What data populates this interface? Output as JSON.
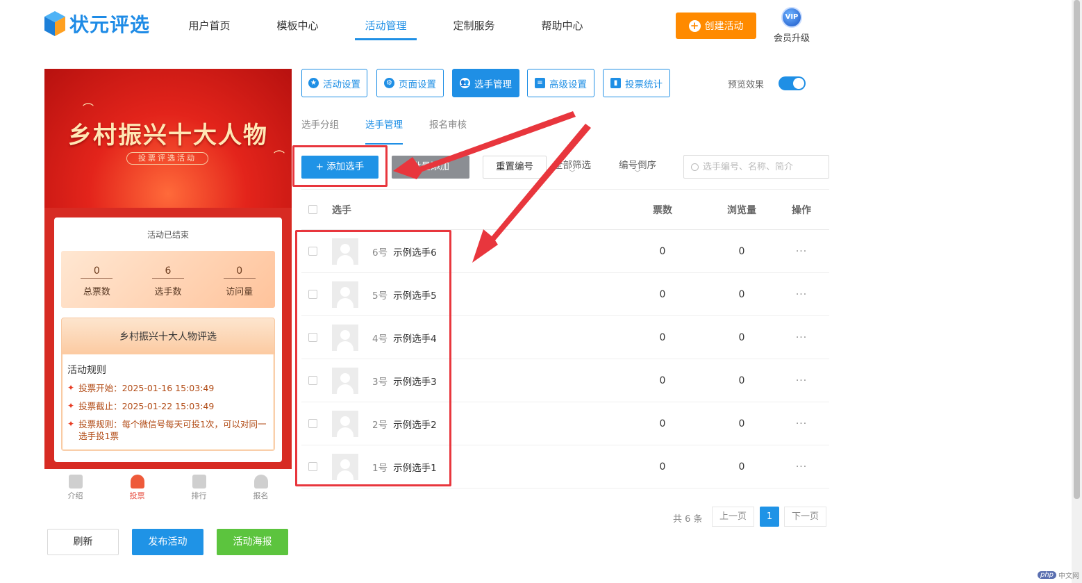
{
  "header": {
    "logo_text": "状元评选",
    "nav": [
      "用户首页",
      "模板中心",
      "活动管理",
      "定制服务",
      "帮助中心"
    ],
    "create_btn": "创建活动",
    "vip_badge": "VIP",
    "vip_label": "会员升级"
  },
  "preview": {
    "banner_title": "乡村振兴十大人物",
    "banner_sub": "投票评选活动",
    "status": "活动已结束",
    "stats": [
      {
        "value": "0",
        "label": "总票数"
      },
      {
        "value": "6",
        "label": "选手数"
      },
      {
        "value": "0",
        "label": "访问量"
      }
    ],
    "activity_name": "乡村振兴十大人物评选",
    "rules_head": "活动规则",
    "rules": [
      "投票开始：2025-01-16 15:03:49",
      "投票截止：2025-01-22 15:03:49",
      "投票规则：每个微信号每天可投1次，可以对同一选手投1票"
    ],
    "tabs": [
      "介绍",
      "投票",
      "排行",
      "报名"
    ]
  },
  "bottom_buttons": {
    "refresh": "刷新",
    "publish": "发布活动",
    "poster": "活动海报"
  },
  "toolbar": {
    "buttons": [
      "活动设置",
      "页面设置",
      "选手管理",
      "高级设置",
      "投票统计"
    ],
    "preview_label": "预览效果",
    "preview_on": true
  },
  "subtabs": [
    "选手分组",
    "选手管理",
    "报名审核"
  ],
  "actions": {
    "add": "+ 添加选手",
    "batch": "批量添加",
    "renumber": "重置编号",
    "filter_all": "全部筛选",
    "sort_desc": "编号倒序",
    "search_placeholder": "选手编号、名称、简介"
  },
  "table": {
    "headers": {
      "player": "选手",
      "votes": "票数",
      "views": "浏览量",
      "ops": "操作"
    },
    "rows": [
      {
        "num": "6号",
        "name": "示例选手6",
        "votes": "0",
        "views": "0",
        "ops": "···"
      },
      {
        "num": "5号",
        "name": "示例选手5",
        "votes": "0",
        "views": "0",
        "ops": "···"
      },
      {
        "num": "4号",
        "name": "示例选手4",
        "votes": "0",
        "views": "0",
        "ops": "···"
      },
      {
        "num": "3号",
        "name": "示例选手3",
        "votes": "0",
        "views": "0",
        "ops": "···"
      },
      {
        "num": "2号",
        "name": "示例选手2",
        "votes": "0",
        "views": "0",
        "ops": "···"
      },
      {
        "num": "1号",
        "name": "示例选手1",
        "votes": "0",
        "views": "0",
        "ops": "···"
      }
    ]
  },
  "pagination": {
    "total": "共 6 条",
    "prev": "上一页",
    "current": "1",
    "next": "下一页"
  },
  "watermark": {
    "php": "php",
    "text": "中文网"
  },
  "colors": {
    "primary": "#1f8fe5",
    "orange": "#ff8a00",
    "green": "#5cc43e",
    "annotation": "#e8363d"
  }
}
